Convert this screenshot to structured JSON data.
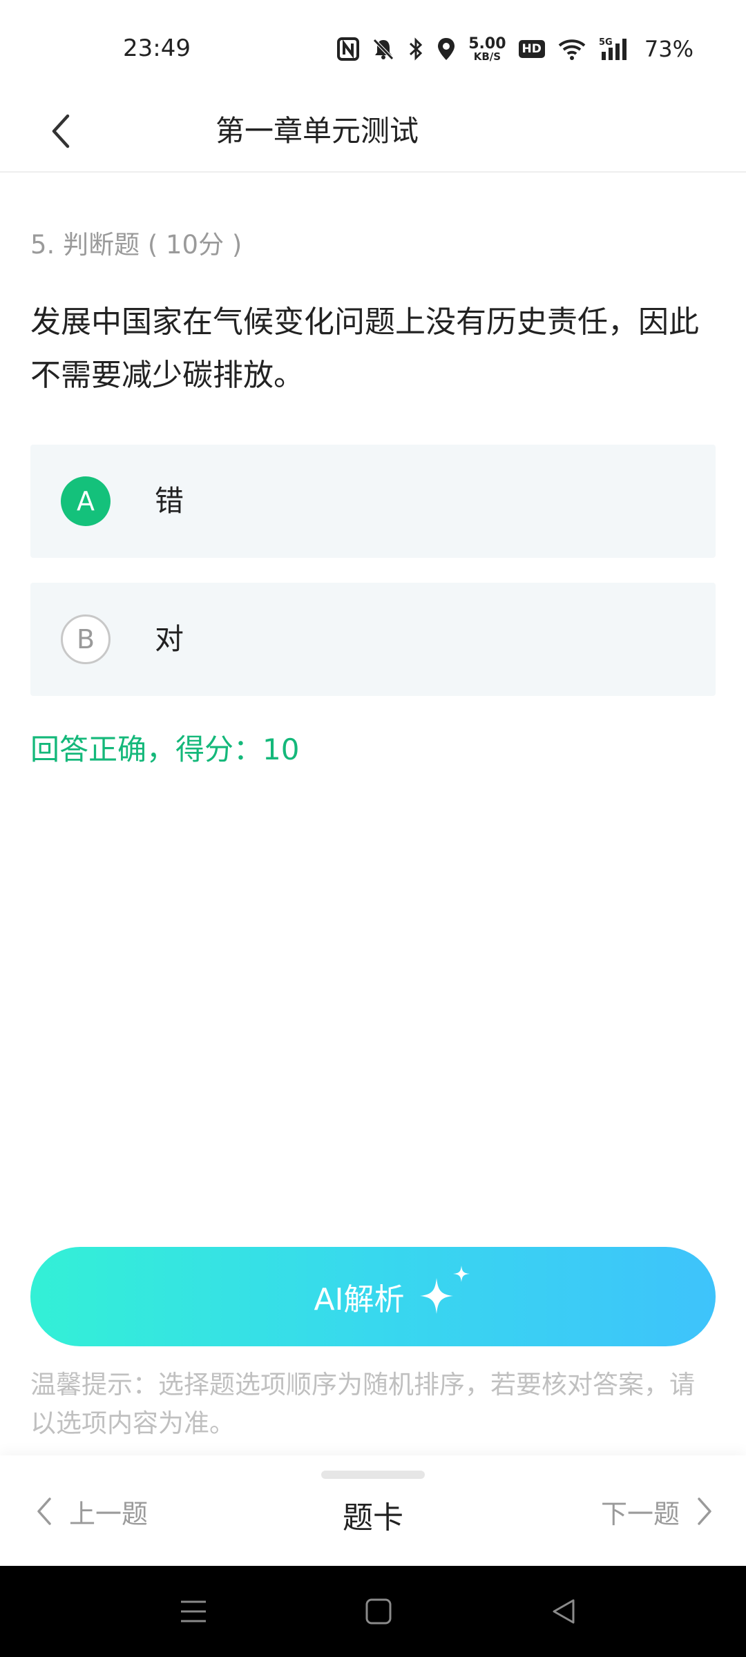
{
  "status_bar": {
    "time": "23:49",
    "net_speed_value": "5.00",
    "net_speed_unit": "KB/S",
    "hd_label": "HD",
    "network_label": "5G",
    "battery": "73%"
  },
  "header": {
    "title": "第一章单元测试"
  },
  "question": {
    "meta": "5. 判断题 ( 10分 )",
    "text": "发展中国家在气候变化问题上没有历史责任，因此不需要减少碳排放。",
    "options": [
      {
        "letter": "A",
        "label": "错",
        "selected": true
      },
      {
        "letter": "B",
        "label": "对",
        "selected": false
      }
    ],
    "result": "回答正确，得分：10"
  },
  "ai_button": {
    "label": "AI解析"
  },
  "tip": "温馨提示：选择题选项顺序为随机排序，若要核对答案，请以选项内容为准。",
  "bottom_nav": {
    "prev_label": "上一题",
    "card_label": "题卡",
    "next_label": "下一题"
  },
  "colors": {
    "accent_green": "#14c17b",
    "gradient_start": "#33f0d6",
    "gradient_end": "#3ec3fb"
  }
}
